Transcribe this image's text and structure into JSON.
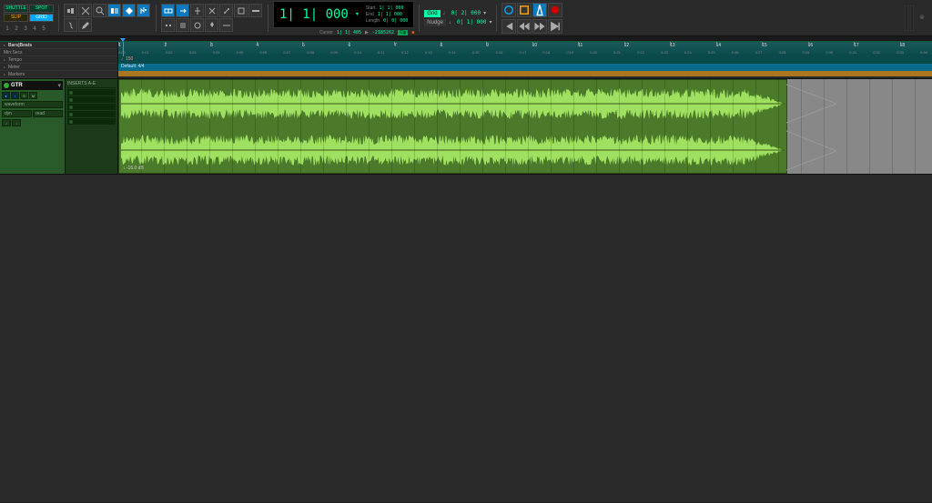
{
  "modes": {
    "shuttle": "SHUTTLE",
    "spot": "SPOT",
    "slip": "SLIP",
    "grid": "GRID"
  },
  "view_numbers": [
    "1",
    "2",
    "3",
    "4",
    "5"
  ],
  "counter": {
    "main": "1| 1| 000",
    "sub": [
      {
        "label": "Start",
        "value": "1| 1| 000"
      },
      {
        "label": "End",
        "value": "1| 1| 000"
      },
      {
        "label": "Length",
        "value": "0| 0| 000"
      }
    ],
    "cursor_label": "Cursor",
    "cursor_pos": "1| 1| 405",
    "cursor_samples": "-2185262",
    "cly": "Cly"
  },
  "grid_nudge": {
    "grid_label": "Grid",
    "grid_note": "♩",
    "grid_value": "0| 2| 000",
    "nudge_label": "Nudge",
    "nudge_note": "♩",
    "nudge_value": "0| 1| 000"
  },
  "rulers": {
    "main": "Bars|Beats",
    "items": [
      "Min:Secs",
      "Tempo",
      "Meter",
      "Markers"
    ],
    "bars": [
      "1",
      "2",
      "3",
      "4",
      "5",
      "6",
      "7",
      "8",
      "9",
      "10",
      "11",
      "12",
      "13",
      "14",
      "15",
      "16",
      "17",
      "18"
    ],
    "times": [
      "0:00",
      "0:01",
      "0:02",
      "0:03",
      "0:04",
      "0:05",
      "0:06",
      "0:07",
      "0:08",
      "0:09",
      "0:10",
      "0:11",
      "0:12",
      "0:13",
      "0:14",
      "0:15",
      "0:16",
      "0:17",
      "0:18",
      "0:19",
      "0:20",
      "0:21",
      "0:22",
      "0:23",
      "0:24",
      "0:25",
      "0:26",
      "0:27",
      "0:28",
      "0:29",
      "0:30",
      "0:31",
      "0:32",
      "0:33",
      "0:34"
    ],
    "tempo": "150",
    "meter": "Default: 4/4"
  },
  "track": {
    "name": "GTR",
    "buttons": [
      "●",
      "I",
      "S",
      "M"
    ],
    "view": "waveform",
    "auto": "dyn",
    "auto2": "read",
    "inserts_title": "INSERTS A-E",
    "clip_label": "↕ -16.0 dB"
  }
}
